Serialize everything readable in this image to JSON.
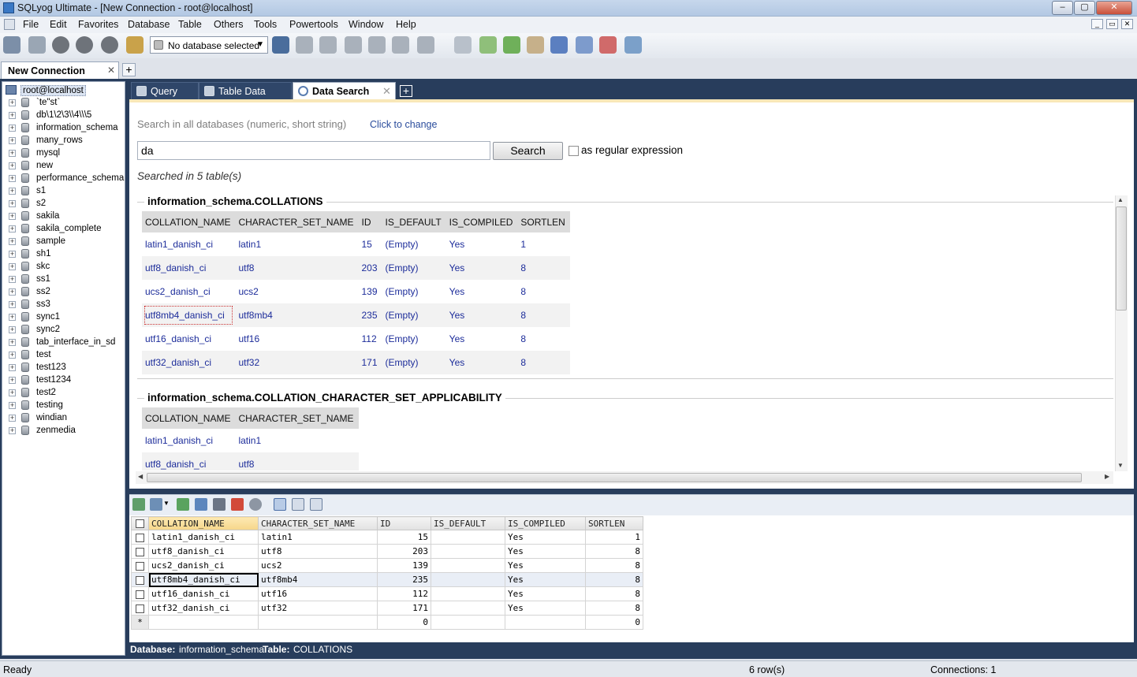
{
  "window": {
    "title": "SQLyog Ultimate - [New Connection - root@localhost]",
    "min": "–",
    "max": "▢",
    "close": "✕"
  },
  "menu": [
    "File",
    "Edit",
    "Favorites",
    "Database",
    "Table",
    "Others",
    "Tools",
    "Powertools",
    "Window",
    "Help"
  ],
  "mdi_controls": [
    "_",
    "▭",
    "✕"
  ],
  "toolbar": {
    "db_select": "No database selected"
  },
  "connection_tab": {
    "label": "New Connection",
    "close": "✕",
    "add": "+"
  },
  "tree": {
    "root": "root@localhost",
    "expander": "+",
    "databases": [
      "`te\"st`",
      "db\\1\\2\\3\\\\4\\\\\\5",
      "information_schema",
      "many_rows",
      "mysql",
      "new",
      "performance_schema",
      "s1",
      "s2",
      "sakila",
      "sakila_complete",
      "sample",
      "sh1",
      "skc",
      "ss1",
      "ss2",
      "ss3",
      "sync1",
      "sync2",
      "tab_interface_in_sd",
      "test",
      "test123",
      "test1234",
      "test2",
      "testing",
      "windian",
      "zenmedia"
    ]
  },
  "query_tabs": [
    {
      "label": "Query"
    },
    {
      "label": "Table Data"
    },
    {
      "label": "Data Search",
      "close": "✕"
    }
  ],
  "query_tab_add": "+",
  "data_search": {
    "scope_text": "Search in all databases (numeric, short string)",
    "click_to_change": "Click to change",
    "search_value": "da",
    "search_button": "Search",
    "regex_label": "as regular expression",
    "searched_summary": "Searched in 5 table(s)"
  },
  "results": [
    {
      "title": "information_schema.COLLATIONS",
      "columns": [
        "COLLATION_NAME",
        "CHARACTER_SET_NAME",
        "ID",
        "IS_DEFAULT",
        "IS_COMPILED",
        "SORTLEN"
      ],
      "rows": [
        [
          "latin1_danish_ci",
          "latin1",
          "15",
          "(Empty)",
          "Yes",
          "1"
        ],
        [
          "utf8_danish_ci",
          "utf8",
          "203",
          "(Empty)",
          "Yes",
          "8"
        ],
        [
          "ucs2_danish_ci",
          "ucs2",
          "139",
          "(Empty)",
          "Yes",
          "8"
        ],
        [
          "utf8mb4_danish_ci",
          "utf8mb4",
          "235",
          "(Empty)",
          "Yes",
          "8"
        ],
        [
          "utf16_danish_ci",
          "utf16",
          "112",
          "(Empty)",
          "Yes",
          "8"
        ],
        [
          "utf32_danish_ci",
          "utf32",
          "171",
          "(Empty)",
          "Yes",
          "8"
        ]
      ]
    },
    {
      "title": "information_schema.COLLATION_CHARACTER_SET_APPLICABILITY",
      "columns": [
        "COLLATION_NAME",
        "CHARACTER_SET_NAME"
      ],
      "rows": [
        [
          "latin1_danish_ci",
          "latin1"
        ],
        [
          "utf8_danish_ci",
          "utf8"
        ]
      ]
    }
  ],
  "grid": {
    "columns": [
      "COLLATION_NAME",
      "CHARACTER_SET_NAME",
      "ID",
      "IS_DEFAULT",
      "IS_COMPILED",
      "SORTLEN"
    ],
    "rows": [
      [
        "latin1_danish_ci",
        "latin1",
        "15",
        "",
        "Yes",
        "1"
      ],
      [
        "utf8_danish_ci",
        "utf8",
        "203",
        "",
        "Yes",
        "8"
      ],
      [
        "ucs2_danish_ci",
        "ucs2",
        "139",
        "",
        "Yes",
        "8"
      ],
      [
        "utf8mb4_danish_ci",
        "utf8mb4",
        "235",
        "",
        "Yes",
        "8"
      ],
      [
        "utf16_danish_ci",
        "utf16",
        "112",
        "",
        "Yes",
        "8"
      ],
      [
        "utf32_danish_ci",
        "utf32",
        "171",
        "",
        "Yes",
        "8"
      ]
    ],
    "new_row_marker": "*",
    "new_row": [
      "",
      "",
      "0",
      "",
      "",
      "0"
    ]
  },
  "info_bar": {
    "db_label": "Database:",
    "db_value": "information_schema",
    "table_label": "Table:",
    "table_value": "COLLATIONS"
  },
  "status": {
    "left": "Ready",
    "rows": "6 row(s)",
    "connections": "Connections: 1"
  },
  "colors": {
    "navy": "#283d5c",
    "link": "#1c2c9a",
    "highlight_header": "#f6d68a"
  }
}
